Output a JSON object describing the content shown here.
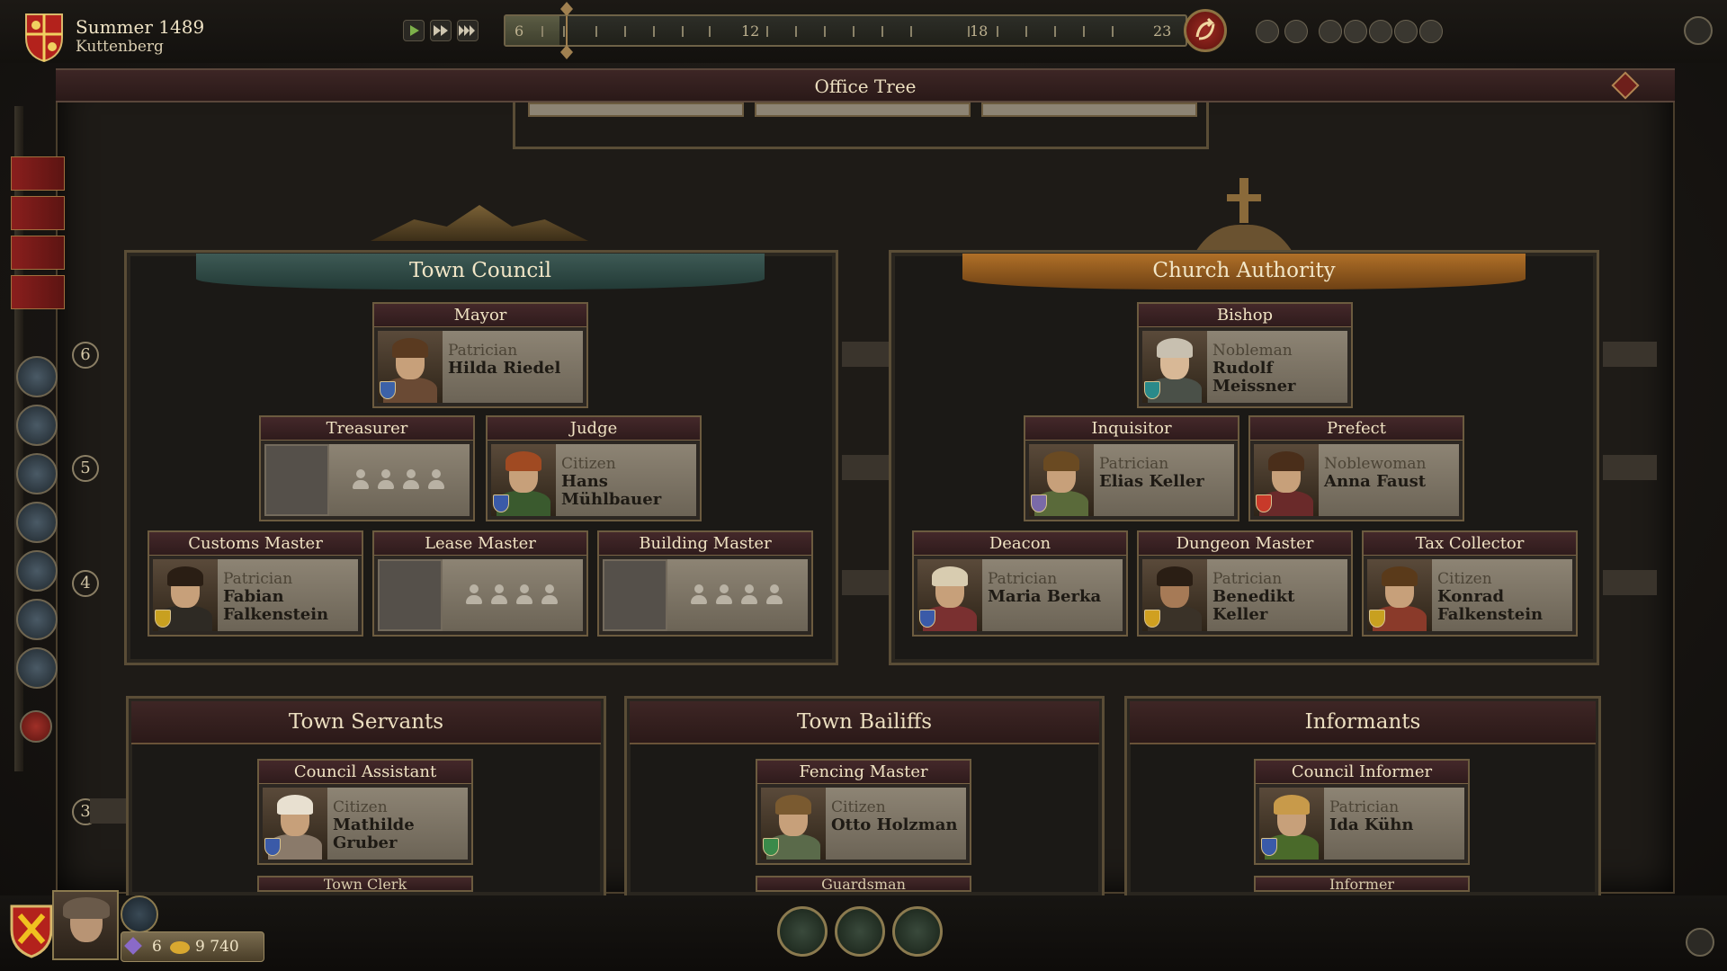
{
  "header": {
    "season": "Summer 1489",
    "town": "Kuttenberg",
    "timeline": {
      "labels": [
        "6",
        "12",
        "18",
        "23"
      ],
      "progress": 0.08
    }
  },
  "panel": {
    "title": "Office Tree"
  },
  "levels": [
    "6",
    "5",
    "4",
    "3"
  ],
  "town_council": {
    "title": "Town Council",
    "mayor": {
      "title": "Mayor",
      "rank": "Patrician",
      "name": "Hilda Riedel"
    },
    "treasurer": {
      "title": "Treasurer"
    },
    "judge": {
      "title": "Judge",
      "rank": "Citizen",
      "name": "Hans Mühlbauer"
    },
    "customs_master": {
      "title": "Customs Master",
      "rank": "Patrician",
      "name": "Fabian Falkenstein"
    },
    "lease_master": {
      "title": "Lease Master"
    },
    "building_master": {
      "title": "Building Master"
    }
  },
  "church": {
    "title": "Church Authority",
    "bishop": {
      "title": "Bishop",
      "rank": "Nobleman",
      "name": "Rudolf Meissner"
    },
    "inquisitor": {
      "title": "Inquisitor",
      "rank": "Patrician",
      "name": "Elias Keller"
    },
    "prefect": {
      "title": "Prefect",
      "rank": "Noblewoman",
      "name": "Anna Faust"
    },
    "deacon": {
      "title": "Deacon",
      "rank": "Patrician",
      "name": "Maria Berka"
    },
    "dungeon_master": {
      "title": "Dungeon Master",
      "rank": "Patrician",
      "name": "Benedikt Keller"
    },
    "tax_collector": {
      "title": "Tax Collector",
      "rank": "Citizen",
      "name": "Konrad Falkenstein"
    }
  },
  "servants": {
    "title": "Town Servants",
    "council_assistant": {
      "title": "Council Assistant",
      "rank": "Citizen",
      "name": "Mathilde Gruber"
    },
    "stub": "Town Clerk"
  },
  "bailiffs": {
    "title": "Town Bailiffs",
    "fencing_master": {
      "title": "Fencing Master",
      "rank": "Citizen",
      "name": "Otto Holzman"
    },
    "stub": "Guardsman"
  },
  "informants": {
    "title": "Informants",
    "council_informer": {
      "title": "Council Informer",
      "rank": "Patrician",
      "name": "Ida Kühn"
    },
    "stub": "Informer"
  },
  "resources": {
    "influence": "6",
    "gold": "9 740"
  },
  "colors": {
    "accent_red": "#8a1f1d",
    "banner_green": "#3e5a55",
    "banner_orange": "#b07028",
    "card_bg": "#8d8474"
  }
}
